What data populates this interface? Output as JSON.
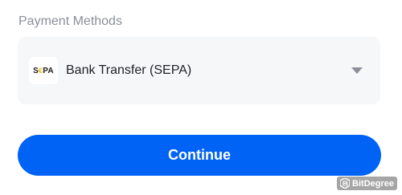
{
  "payment": {
    "section_label": "Payment Methods",
    "selected_method": {
      "logo_text_left": "S",
      "logo_text_stars": "€",
      "logo_text_right": "PA",
      "label": "Bank Transfer (SEPA)",
      "icon": "chevron-down-icon"
    }
  },
  "actions": {
    "continue_label": "Continue"
  },
  "watermark": {
    "text": "BitDegree"
  },
  "colors": {
    "accent": "#0063f5",
    "muted_text": "#8a8f98",
    "field_bg": "#f6f7f9"
  }
}
